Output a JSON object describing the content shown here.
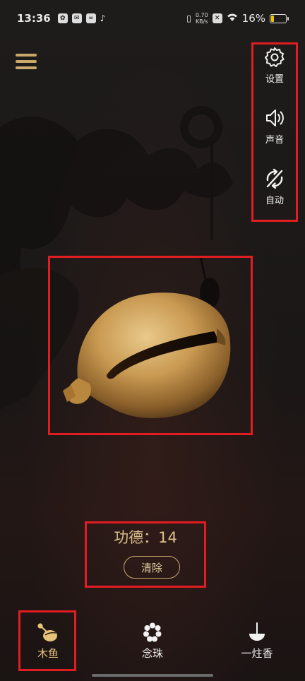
{
  "status_bar": {
    "time": "13:36",
    "net_speed_value": "0.70",
    "net_speed_unit": "KB/s",
    "battery": "16%",
    "battery_level": 0.16
  },
  "side_controls": {
    "settings_label": "设置",
    "sound_label": "声音",
    "auto_label": "自动"
  },
  "merit": {
    "label": "功德：",
    "count": "14",
    "clear_label": "清除"
  },
  "bottom_nav": {
    "items": [
      {
        "label": "木鱼",
        "icon": "mallet-icon",
        "active": true
      },
      {
        "label": "念珠",
        "icon": "beads-icon",
        "active": false
      },
      {
        "label": "一炷香",
        "icon": "incense-icon",
        "active": false
      }
    ]
  },
  "colors": {
    "accent_gold": "#c9a86b",
    "highlight_red": "#e11d21",
    "active_nav_text": "#e6c27a"
  }
}
